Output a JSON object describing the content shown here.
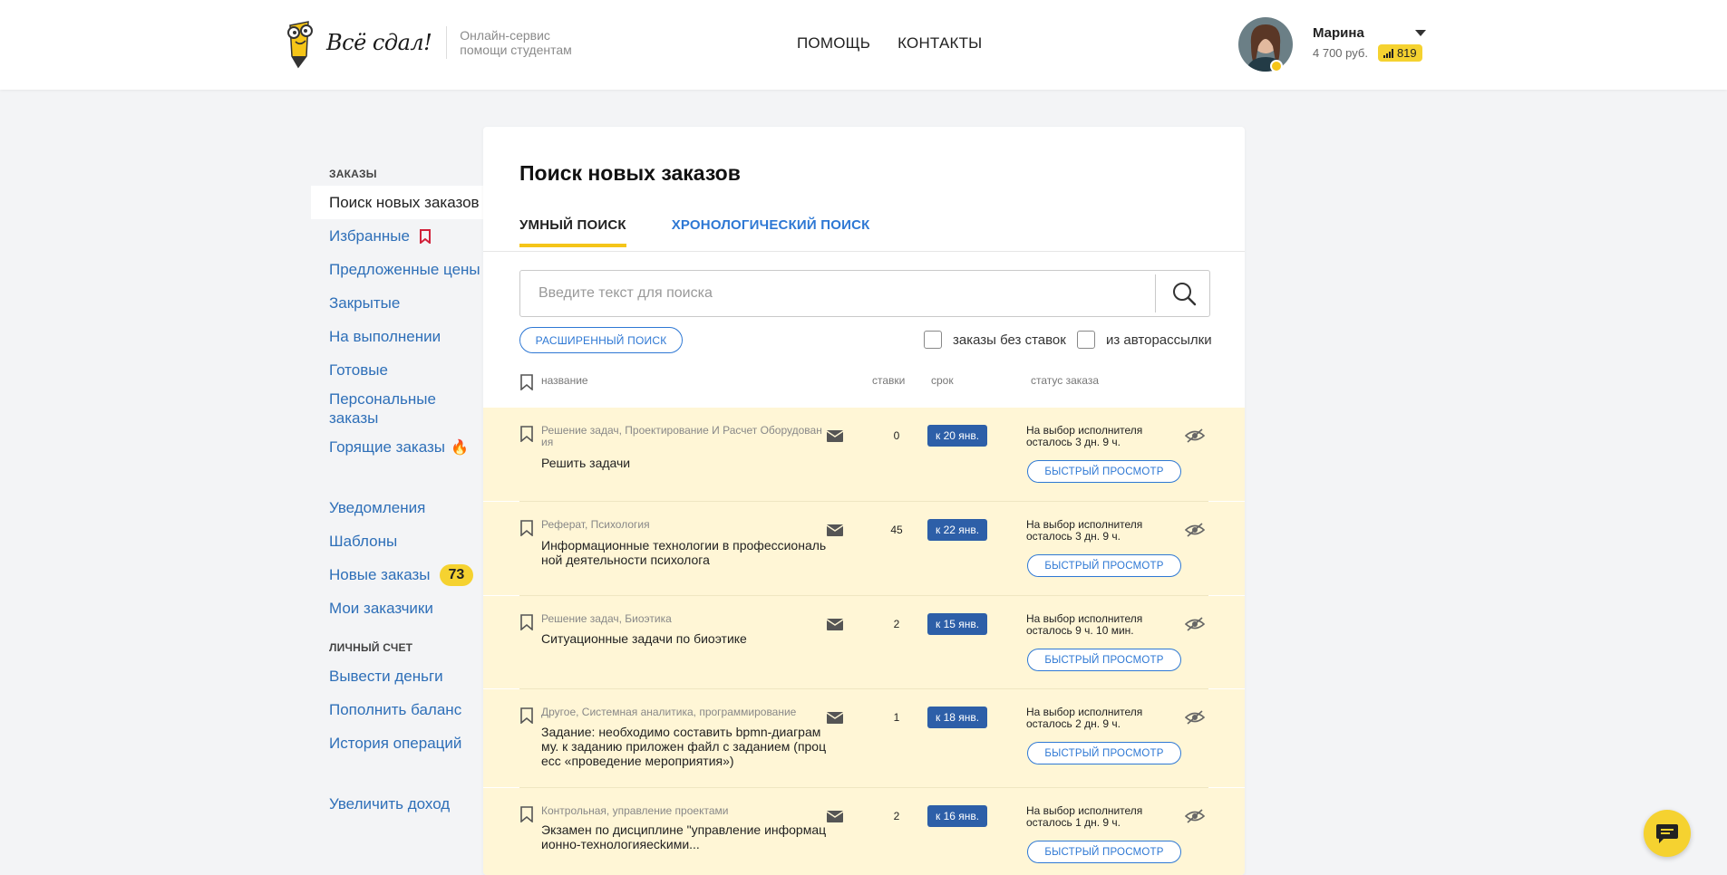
{
  "header": {
    "logo_text": "Всё сдал!",
    "tagline_line1": "Онлайн-сервис",
    "tagline_line2": "помощи студентам",
    "nav": [
      {
        "label": "ПОМОЩЬ"
      },
      {
        "label": "КОНТАКТЫ"
      }
    ],
    "user": {
      "name": "Марина",
      "balance": "4 700 руб.",
      "rating": "819"
    }
  },
  "sidebar": {
    "orders_heading": "ЗАКАЗЫ",
    "items": [
      {
        "label": "Поиск новых заказов"
      },
      {
        "label": "Избранные"
      },
      {
        "label": "Предложенные цены"
      },
      {
        "label": "Закрытые"
      },
      {
        "label": "На выполнении"
      },
      {
        "label": "Готовые"
      },
      {
        "label": "Персональные заказы"
      },
      {
        "label": "Горящие заказы"
      }
    ],
    "items2": [
      {
        "label": "Уведомления"
      },
      {
        "label": "Шаблоны"
      },
      {
        "label": "Новые заказы",
        "badge": "73"
      },
      {
        "label": "Мои заказчики"
      }
    ],
    "account_heading": "ЛИЧНЫЙ СЧЕТ",
    "items3": [
      {
        "label": "Вывести деньги"
      },
      {
        "label": "Пополнить баланс"
      },
      {
        "label": "История операций"
      }
    ],
    "increase_income": "Увеличить доход"
  },
  "main": {
    "title": "Поиск новых заказов",
    "tabs": [
      {
        "label": "УМНЫЙ ПОИСК"
      },
      {
        "label": "ХРОНОЛОГИЧЕСКИЙ ПОИСК"
      }
    ],
    "search": {
      "placeholder": "Введите текст для поиска",
      "value": ""
    },
    "advanced_search": "РАСШИРЕННЫЙ ПОИСК",
    "filter_no_bids": "заказы без ставок",
    "filter_auto": "из авторассылки",
    "columns": {
      "name": "название",
      "bids": "ставки",
      "deadline": "срок",
      "status": "статус заказа"
    },
    "quick_view_label": "БЫСТРЫЙ ПРОСМОТР",
    "orders": [
      {
        "category": "Решение задач, Проектирование И Расчет Оборудования",
        "title": "Решить задачи",
        "bids": "0",
        "deadline": "к 20 янв.",
        "status_line1": "На выбор исполнителя",
        "status_line2": "осталось 3 дн. 9 ч."
      },
      {
        "category": "Реферат, Психология",
        "title": "Информационные технологии в профессиональной деятельности психолога",
        "bids": "45",
        "deadline": "к 22 янв.",
        "status_line1": "На выбор исполнителя",
        "status_line2": "осталось 3 дн. 9 ч."
      },
      {
        "category": "Решение задач, Биоэтика",
        "title": "Ситуационные задачи по биоэтике",
        "bids": "2",
        "deadline": "к 15 янв.",
        "status_line1": "На выбор исполнителя",
        "status_line2": "осталось 9 ч. 10 мин."
      },
      {
        "category": "Другое, Системная аналитика, программирование",
        "title": "Задание: необходимо составить bpmn-диаграмму. к заданию приложен файл с заданием (процесс «проведение мероприятия»)",
        "bids": "1",
        "deadline": "к 18 янв.",
        "status_line1": "На выбор исполнителя",
        "status_line2": "осталось 2 дн. 9 ч."
      },
      {
        "category": "Контрольная, управление проектами",
        "title": "Экзамен по дисциплине \"управление информационно-технологияесkими...",
        "bids": "2",
        "deadline": "к 16 янв.",
        "status_line1": "На выбор исполнителя",
        "status_line2": "осталось 1 дн. 9 ч."
      }
    ]
  },
  "colors": {
    "accent_yellow": "#f5d230",
    "link_blue": "#2e78d4",
    "deadline_blue": "#2d5fa8",
    "row_highlight": "#fff6d6"
  }
}
